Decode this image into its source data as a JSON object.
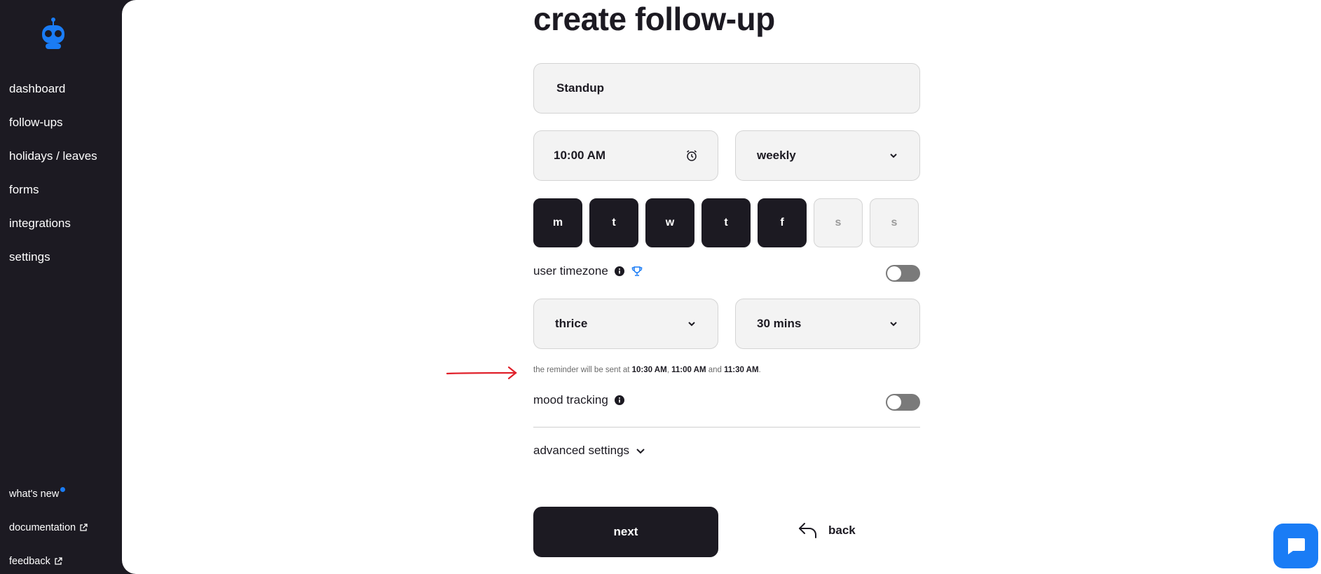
{
  "sidebar": {
    "nav": [
      "dashboard",
      "follow-ups",
      "holidays / leaves",
      "forms",
      "integrations",
      "settings"
    ],
    "bottom": {
      "whats_new": "what's new",
      "documentation": "documentation",
      "feedback": "feedback"
    }
  },
  "page": {
    "title": "create follow-up",
    "name_value": "Standup",
    "time_value": "10:00 AM",
    "frequency_value": "weekly",
    "days": [
      {
        "label": "m",
        "selected": true
      },
      {
        "label": "t",
        "selected": true
      },
      {
        "label": "w",
        "selected": true
      },
      {
        "label": "t",
        "selected": true
      },
      {
        "label": "f",
        "selected": true
      },
      {
        "label": "s",
        "selected": false
      },
      {
        "label": "s",
        "selected": false
      }
    ],
    "user_timezone_label": "user timezone",
    "user_timezone_on": false,
    "reminder_count_value": "thrice",
    "reminder_interval_value": "30 mins",
    "hint": {
      "prefix": "the reminder will be sent at ",
      "t1": "10:30 AM",
      "sep1": ", ",
      "t2": "11:00 AM",
      "sep2": " and ",
      "t3": "11:30 AM",
      "suffix": "."
    },
    "mood_tracking_label": "mood tracking",
    "mood_tracking_on": false,
    "advanced_label": "advanced settings",
    "next_label": "next",
    "back_label": "back"
  },
  "colors": {
    "dark": "#1c1a22",
    "accent": "#1a7cf5",
    "annotation_arrow": "#e0202a"
  }
}
